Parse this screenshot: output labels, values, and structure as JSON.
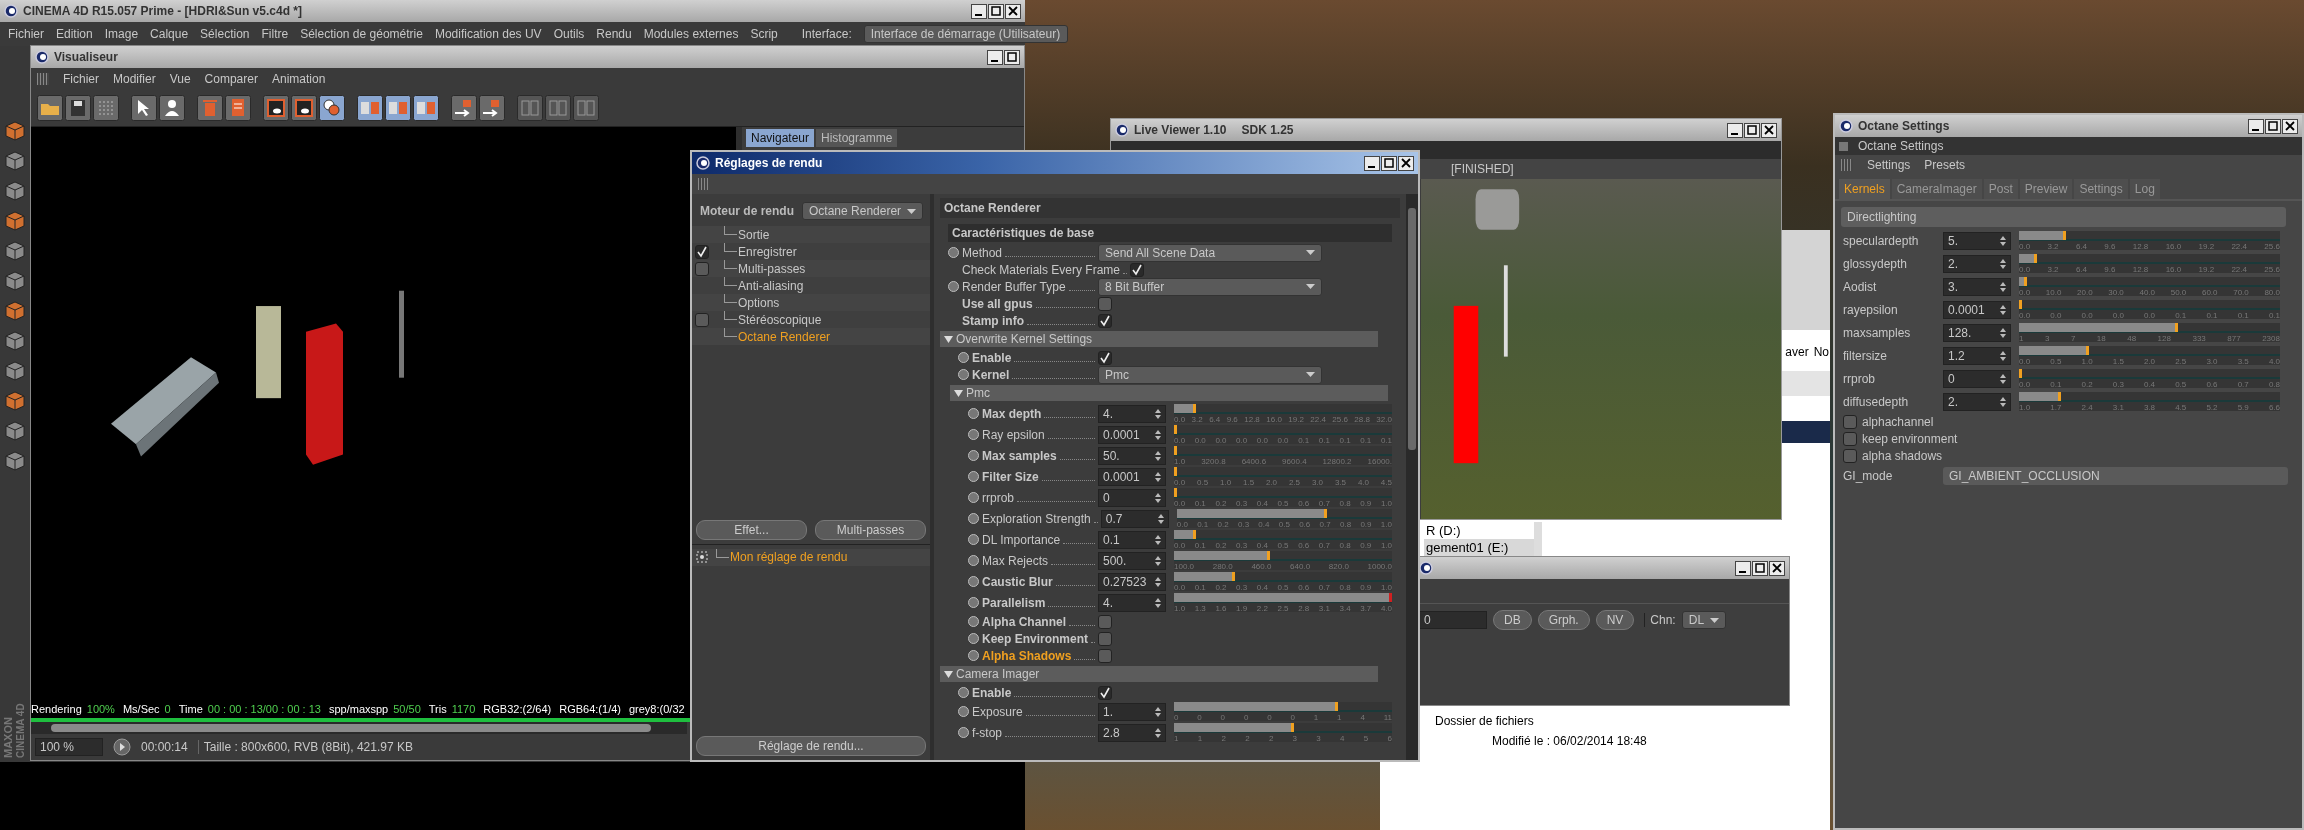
{
  "c4d": {
    "title": "CINEMA 4D R15.057 Prime - [HDRI&Sun v5.c4d *]",
    "active": false,
    "menu": [
      "Fichier",
      "Edition",
      "Image",
      "Calque",
      "Sélection",
      "Filtre",
      "Sélection de géométrie",
      "Modification des UV",
      "Outils",
      "Rendu",
      "Modules externes",
      "Scrip"
    ],
    "interface_label": "Interface:",
    "interface_value": "Interface de démarrage (Utilisateur)",
    "logo": [
      "MAXON",
      "CINEMA 4D"
    ]
  },
  "visualiseur": {
    "title": "Visualiseur",
    "active": false,
    "menu": [
      "Fichier",
      "Modifier",
      "Vue",
      "Comparer",
      "Animation"
    ],
    "nav_tabs": [
      {
        "label": "Navigateur",
        "selected": true
      },
      {
        "label": "Histogramme",
        "selected": false
      }
    ],
    "status": [
      {
        "text": "Rendering",
        "kind": "label"
      },
      {
        "text": "100%",
        "kind": "value"
      },
      {
        "text": "Ms/Sec",
        "kind": "label"
      },
      {
        "text": "0",
        "kind": "value"
      },
      {
        "text": "Time",
        "kind": "label"
      },
      {
        "text": "00 : 00 : 13/00 : 00 : 13",
        "kind": "value"
      },
      {
        "text": "spp/maxspp",
        "kind": "label"
      },
      {
        "text": "50/50",
        "kind": "value"
      },
      {
        "text": "Tris",
        "kind": "label"
      },
      {
        "text": "1170",
        "kind": "value"
      },
      {
        "text": "RGB32:(2/64)",
        "kind": "label"
      },
      {
        "text": "RGB64:(1/4)",
        "kind": "label"
      },
      {
        "text": "grey8:(0/32",
        "kind": "label"
      }
    ],
    "progress": {
      "level": 1
    },
    "zoom": "100 %",
    "time": "00:00:14",
    "info": "Taille : 800x600, RVB (8Bit), 421.97 KB"
  },
  "explorer": {
    "extra": [
      "aver",
      "No"
    ],
    "drives": [
      {
        "label": "R (D:)",
        "selected": false
      },
      {
        "label": "gement01 (E:)",
        "selected": true
      }
    ],
    "folder_type": "Dossier de fichiers",
    "modified": "Modifié le : 06/02/2014 18:48"
  },
  "aux_window": {
    "active": false,
    "field": "0",
    "buttons": [
      "DB",
      "Grph.",
      "NV"
    ],
    "channel_label": "Chn:",
    "channel": "DL"
  },
  "live_viewer": {
    "title": "Live Viewer 1.10",
    "sdk": "SDK 1.25",
    "active": false,
    "status": "[FINISHED]"
  },
  "render_settings": {
    "title": "Réglages de rendu",
    "active": true,
    "engine_label": "Moteur de rendu",
    "engine_value": "Octane Renderer",
    "tree": [
      {
        "label": "Sortie",
        "kind": "plain",
        "selected": false
      },
      {
        "label": "Enregistrer",
        "kind": "check",
        "checked": true,
        "selected": false
      },
      {
        "label": "Multi-passes",
        "kind": "check",
        "checked": false,
        "selected": false
      },
      {
        "label": "Anti-aliasing",
        "kind": "plain",
        "selected": false
      },
      {
        "label": "Options",
        "kind": "plain",
        "selected": false
      },
      {
        "label": "Stéréoscopique",
        "kind": "check",
        "checked": false,
        "selected": false
      },
      {
        "label": "Octane Renderer",
        "kind": "plain",
        "selected": true
      }
    ],
    "buttons": [
      "Effet...",
      "Multi-passes"
    ],
    "preset": "Mon réglage de rendu",
    "bottom_button": "Réglage de rendu...",
    "panel_title": "Octane Renderer",
    "rows": [
      {
        "kind": "section",
        "label": "Caractéristiques de base"
      },
      {
        "kind": "dropdown",
        "label": "Method",
        "keyframe": true,
        "bold": false,
        "value": "Send All Scene Data"
      },
      {
        "kind": "check",
        "label": "Check Materials Every Frame",
        "keyframe": false,
        "bold": false,
        "checked": true,
        "highlighted": false
      },
      {
        "kind": "dropdown",
        "label": "Render Buffer Type",
        "keyframe": true,
        "bold": false,
        "value": "8 Bit Buffer"
      },
      {
        "kind": "check",
        "label": "Use all gpus",
        "keyframe": false,
        "bold": true,
        "checked": false,
        "highlighted": false
      },
      {
        "kind": "check",
        "label": "Stamp info",
        "keyframe": false,
        "bold": true,
        "checked": true,
        "highlighted": false
      },
      {
        "kind": "group",
        "label": "Overwrite Kernel Settings",
        "expanded": true,
        "children": [
          {
            "kind": "check",
            "label": "Enable",
            "keyframe": true,
            "bold": true,
            "checked": true,
            "highlighted": false
          },
          {
            "kind": "dropdown",
            "label": "Kernel",
            "keyframe": true,
            "bold": true,
            "value": "Pmc"
          },
          {
            "kind": "group",
            "label": "Pmc",
            "expanded": true,
            "children": [
              {
                "kind": "slider",
                "label": "Max depth",
                "keyframe": true,
                "bold": true,
                "value": "4.",
                "level": 0.1,
                "ticks": [
                  "0.0",
                  "3.2",
                  "6.4",
                  "9.6",
                  "12.8",
                  "16.0",
                  "19.2",
                  "22.4",
                  "25.6",
                  "28.8",
                  "32.0"
                ]
              },
              {
                "kind": "slider",
                "label": "Ray epsilon",
                "keyframe": true,
                "bold": false,
                "value": "0.0001",
                "level": 0,
                "ticks": [
                  "0.0",
                  "0.0",
                  "0.0",
                  "0.0",
                  "0.0",
                  "0.0",
                  "0.1",
                  "0.1",
                  "0.1",
                  "0.1",
                  "0.1"
                ]
              },
              {
                "kind": "slider",
                "label": "Max samples",
                "keyframe": true,
                "bold": true,
                "value": "50.",
                "level": 0,
                "ticks": [
                  "1.0",
                  "3200.8",
                  "6400.6",
                  "9600.4",
                  "12800.2",
                  "16000."
                ]
              },
              {
                "kind": "slider",
                "label": "Filter Size",
                "keyframe": true,
                "bold": true,
                "value": "0.0001",
                "level": 0,
                "ticks": [
                  "0.0",
                  "0.5",
                  "1.0",
                  "1.5",
                  "2.0",
                  "2.5",
                  "3.0",
                  "3.5",
                  "4.0",
                  "4.5"
                ]
              },
              {
                "kind": "slider",
                "label": "rrprob",
                "keyframe": true,
                "bold": false,
                "value": "0",
                "level": 0,
                "ticks": [
                  "0.0",
                  "0.1",
                  "0.2",
                  "0.3",
                  "0.4",
                  "0.5",
                  "0.6",
                  "0.7",
                  "0.8",
                  "0.9",
                  "1.0"
                ]
              },
              {
                "kind": "slider",
                "label": "Exploration Strength",
                "keyframe": true,
                "bold": false,
                "value": "0.7",
                "level": 0.7,
                "ticks": [
                  "0.0",
                  "0.1",
                  "0.2",
                  "0.3",
                  "0.4",
                  "0.5",
                  "0.6",
                  "0.7",
                  "0.8",
                  "0.9",
                  "1.0"
                ]
              },
              {
                "kind": "slider",
                "label": "DL Importance",
                "keyframe": true,
                "bold": false,
                "value": "0.1",
                "level": 0.1,
                "ticks": [
                  "0.0",
                  "0.1",
                  "0.2",
                  "0.3",
                  "0.4",
                  "0.5",
                  "0.6",
                  "0.7",
                  "0.8",
                  "0.9",
                  "1.0"
                ]
              },
              {
                "kind": "slider",
                "label": "Max Rejects",
                "keyframe": true,
                "bold": false,
                "value": "500.",
                "level": 0.44,
                "ticks": [
                  "100.0",
                  "280.0",
                  "460.0",
                  "640.0",
                  "820.0",
                  "1000.0"
                ]
              },
              {
                "kind": "slider",
                "label": "Caustic Blur",
                "keyframe": true,
                "bold": true,
                "value": "0.27523",
                "level": 0.28,
                "ticks": [
                  "0.0",
                  "0.1",
                  "0.2",
                  "0.3",
                  "0.4",
                  "0.5",
                  "0.6",
                  "0.7",
                  "0.8",
                  "0.9",
                  "1.0"
                ]
              },
              {
                "kind": "slider",
                "label": "Parallelism",
                "keyframe": true,
                "bold": true,
                "value": "4.",
                "level": 1,
                "ticks": [
                  "1.0",
                  "1.3",
                  "1.6",
                  "1.9",
                  "2.2",
                  "2.5",
                  "2.8",
                  "3.1",
                  "3.4",
                  "3.7",
                  "4.0"
                ]
              },
              {
                "kind": "check",
                "label": "Alpha Channel",
                "keyframe": true,
                "bold": true,
                "checked": false,
                "highlighted": false
              },
              {
                "kind": "check",
                "label": "Keep Environment",
                "keyframe": true,
                "bold": true,
                "checked": false,
                "highlighted": false
              },
              {
                "kind": "check",
                "label": "Alpha Shadows",
                "keyframe": true,
                "bold": true,
                "checked": false,
                "highlighted": true
              }
            ]
          }
        ]
      },
      {
        "kind": "group",
        "label": "Camera Imager",
        "expanded": true,
        "children": [
          {
            "kind": "check",
            "label": "Enable",
            "keyframe": true,
            "bold": true,
            "checked": true,
            "highlighted": false
          },
          {
            "kind": "slider",
            "label": "Exposure",
            "keyframe": true,
            "bold": false,
            "value": "1.",
            "level": 0.75,
            "ticks": [
              "0",
              "0",
              "0",
              "0",
              "0",
              "0",
              "1",
              "1",
              "4",
              "11"
            ]
          },
          {
            "kind": "slider",
            "label": "f-stop",
            "keyframe": true,
            "bold": false,
            "value": "2.8",
            "level": 0.55,
            "ticks": [
              "1",
              "1",
              "2",
              "2",
              "2",
              "3",
              "3",
              "4",
              "5",
              "6"
            ]
          }
        ]
      }
    ]
  },
  "octane": {
    "title": "Octane Settings",
    "active": false,
    "subtitle": "Octane Settings",
    "menu": [
      "Settings",
      "Presets"
    ],
    "tabs": [
      {
        "label": "Kernels",
        "selected": true
      },
      {
        "label": "CameraImager",
        "selected": false
      },
      {
        "label": "Post",
        "selected": false
      },
      {
        "label": "Preview",
        "selected": false
      },
      {
        "label": "Settings",
        "selected": false
      },
      {
        "label": "Log",
        "selected": false
      }
    ],
    "group": "Directlighting",
    "rows": [
      {
        "kind": "slider",
        "label": "speculardepth",
        "value": "5.",
        "level": 0.18,
        "ticks": [
          "0.0",
          "3.2",
          "6.4",
          "9.6",
          "12.8",
          "16.0",
          "19.2",
          "22.4",
          "25.6"
        ]
      },
      {
        "kind": "slider",
        "label": "glossydepth",
        "value": "2.",
        "level": 0.07,
        "ticks": [
          "0.0",
          "3.2",
          "6.4",
          "9.6",
          "12.8",
          "16.0",
          "19.2",
          "22.4",
          "25.6"
        ]
      },
      {
        "kind": "slider",
        "label": "Aodist",
        "value": "3.",
        "level": 0.03,
        "ticks": [
          "0.0",
          "10.0",
          "20.0",
          "30.0",
          "40.0",
          "50.0",
          "60.0",
          "70.0",
          "80.0"
        ]
      },
      {
        "kind": "slider",
        "label": "rayepsilon",
        "value": "0.0001",
        "level": 0,
        "ticks": [
          "0.0",
          "0.0",
          "0.0",
          "0.0",
          "0.0",
          "0.1",
          "0.1",
          "0.1",
          "0.1"
        ]
      },
      {
        "kind": "slider",
        "label": "maxsamples",
        "value": "128.",
        "level": 0.61,
        "ticks": [
          "1",
          "3",
          "7",
          "18",
          "48",
          "128",
          "333",
          "877",
          "2308"
        ]
      },
      {
        "kind": "slider",
        "label": "filtersize",
        "value": "1.2",
        "level": 0.27,
        "ticks": [
          "0.0",
          "0.5",
          "1.0",
          "1.5",
          "2.0",
          "2.5",
          "3.0",
          "3.5",
          "4.0"
        ]
      },
      {
        "kind": "slider",
        "label": "rrprob",
        "value": "0",
        "level": 0,
        "ticks": [
          "0.0",
          "0.1",
          "0.2",
          "0.3",
          "0.4",
          "0.5",
          "0.6",
          "0.7",
          "0.8"
        ]
      },
      {
        "kind": "slider",
        "label": "diffusedepth",
        "value": "2.",
        "level": 0.16,
        "ticks": [
          "1.0",
          "1.7",
          "2.4",
          "3.1",
          "3.8",
          "4.5",
          "5.2",
          "5.9",
          "6.6"
        ]
      },
      {
        "kind": "check",
        "label": "alphachannel",
        "checked": false
      },
      {
        "kind": "check",
        "label": "keep environment",
        "checked": false
      },
      {
        "kind": "check",
        "label": "alpha shadows",
        "checked": false
      },
      {
        "kind": "dropdown",
        "label": "GI_mode",
        "value": "GI_AMBIENT_OCCLUSION"
      }
    ]
  }
}
